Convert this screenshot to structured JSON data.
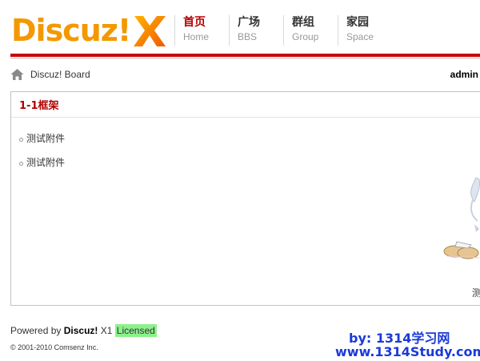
{
  "brand": {
    "logo_text": "Discuz!",
    "accent": "#f39800",
    "red": "#b20000"
  },
  "nav": {
    "items": [
      {
        "cn": "首页",
        "en": "Home",
        "active": true
      },
      {
        "cn": "广场",
        "en": "BBS",
        "active": false
      },
      {
        "cn": "群组",
        "en": "Group",
        "active": false
      },
      {
        "cn": "家园",
        "en": "Space",
        "active": false
      }
    ]
  },
  "breadcrumb": {
    "text": "Discuz! Board"
  },
  "user": {
    "name": "admin"
  },
  "panel": {
    "title": "1-1框架",
    "items": [
      "测试附件",
      "测试附件"
    ],
    "corner_text": "测"
  },
  "footer": {
    "powered_by": "Powered by",
    "product": "Discuz!",
    "version": "X1",
    "license": "Licensed",
    "copyright": "© 2001-2010 Comsenz Inc."
  },
  "watermark": {
    "line1": "by: 1314学习网",
    "line2": "www.1314Study.com"
  }
}
